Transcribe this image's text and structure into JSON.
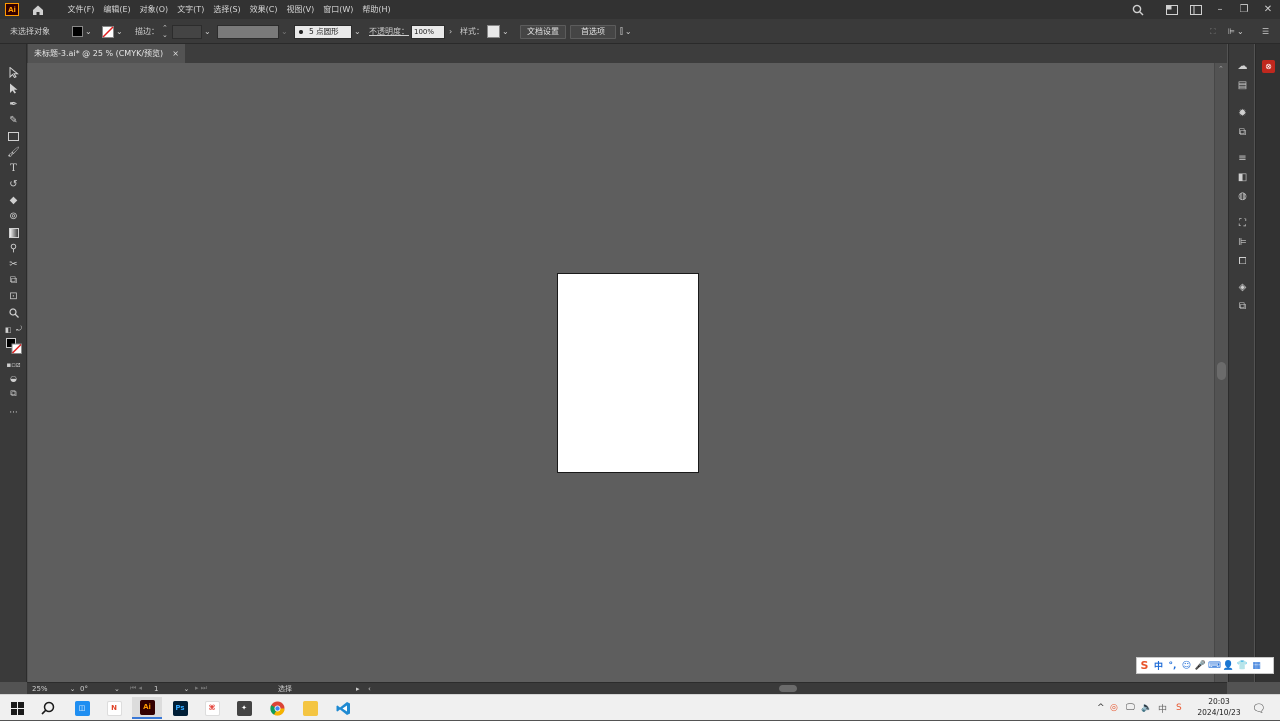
{
  "app": {
    "logo_text": "Ai"
  },
  "menu": [
    "文件(F)",
    "编辑(E)",
    "对象(O)",
    "文字(T)",
    "选择(S)",
    "效果(C)",
    "视图(V)",
    "窗口(W)",
    "帮助(H)"
  ],
  "control_bar": {
    "selection_status": "未选择对象",
    "stroke_label": "描边：",
    "brush_label": "5 点圆形",
    "opacity_label": "不透明度：",
    "opacity_value": "100%",
    "style_label": "样式：",
    "doc_settings_button": "文档设置",
    "preferences_button": "首选项"
  },
  "document_tab": {
    "title": "未标题-3.ai* @ 25 % (CMYK/预览)",
    "close": "×"
  },
  "status_bar": {
    "zoom": "25%",
    "rotation": "0°",
    "artboard_number": "1",
    "tool_status": "选择"
  },
  "taskbar": {
    "time": "20:03",
    "date": "2024/10/23",
    "apps": [
      "start",
      "search",
      "tencent-meeting",
      "navicat",
      "illustrator",
      "photoshop",
      "acrobat",
      "inkscape-app",
      "chrome",
      "file-explorer",
      "vscode"
    ],
    "app_labels": {
      "illustrator": "Ai",
      "photoshop": "Ps",
      "navicat": "N",
      "ime_language": "中"
    }
  },
  "colors": {
    "accent": "#ff9a00",
    "canvas_bg": "#5e5e5e",
    "panel_bg": "#3a3a3a",
    "artboard": "#ffffff"
  }
}
